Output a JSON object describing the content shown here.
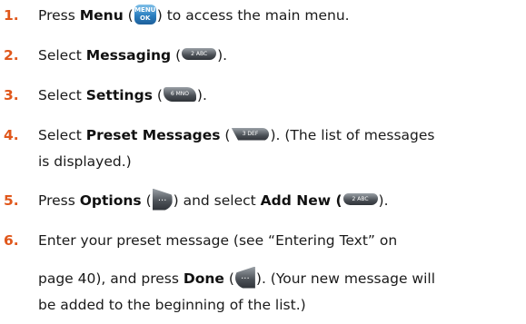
{
  "steps": [
    {
      "num": "1.",
      "pre": "Press ",
      "bold": "Menu",
      "paren_open": " (",
      "paren_close": ") to access the main menu.",
      "key": {
        "line1": "MENU",
        "line2": "OK"
      }
    },
    {
      "num": "2.",
      "pre": "Select ",
      "bold": "Messaging",
      "paren_open": " (",
      "paren_close": ").",
      "key": {
        "label": "2 ABC"
      }
    },
    {
      "num": "3.",
      "pre": "Select ",
      "bold": "Settings",
      "paren_open": " (",
      "paren_close": ").",
      "key": {
        "label": "6 MNO"
      }
    },
    {
      "num": "4.",
      "pre": "Select ",
      "bold": "Preset Messages",
      "paren_open": " (",
      "paren_close": "). (The list of messages",
      "line2": "is displayed.)",
      "key": {
        "label": "3 DEF"
      }
    },
    {
      "num": "5.",
      "pre": "Press ",
      "bold": "Options",
      "paren_open": " (",
      "mid": ") and select ",
      "bold2": "Add New",
      "paren_open2": " (",
      "paren_close": ").",
      "key": {
        "label": "···"
      },
      "key2": {
        "label": "2 ABC"
      }
    },
    {
      "num": "6.",
      "line1": "Enter your preset message (see “Entering Text” on",
      "pre2": "page 40), and press ",
      "bold": "Done",
      "paren_open": " (",
      "paren_close": "). (Your new message will",
      "line3": "be added to the beginning of the list.)",
      "key": {
        "label": "···"
      }
    }
  ]
}
